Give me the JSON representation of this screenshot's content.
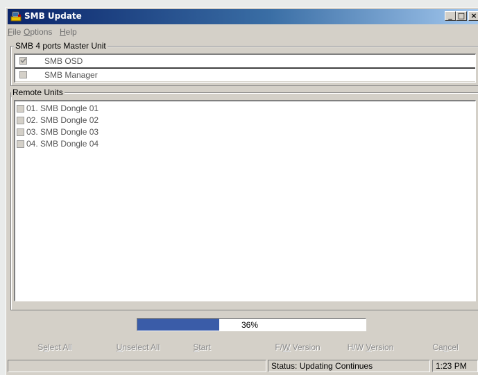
{
  "window": {
    "title": "SMB Update",
    "controls": {
      "minimize": "_",
      "maximize": "□",
      "close": "×"
    }
  },
  "menu": [
    {
      "key": "F",
      "rest": "ile"
    },
    {
      "key": "O",
      "rest": "ptions"
    },
    {
      "key": "H",
      "rest": "elp"
    }
  ],
  "master_unit": {
    "label": "SMB 4 ports Master Unit",
    "items": [
      {
        "label": "SMB OSD",
        "checked": true
      },
      {
        "label": "SMB Manager",
        "checked": false
      }
    ]
  },
  "remote_units": {
    "label": "Remote Units",
    "items": [
      {
        "label": "01. SMB Dongle 01",
        "checked": false
      },
      {
        "label": "02. SMB Dongle 02",
        "checked": false
      },
      {
        "label": "03. SMB Dongle 03",
        "checked": false
      },
      {
        "label": "04. SMB Dongle 04",
        "checked": false
      }
    ]
  },
  "progress": {
    "percent": 36,
    "text": "36%"
  },
  "buttons": {
    "select_all": {
      "pre": "S",
      "key": "e",
      "post": "lect All"
    },
    "unselect_all": {
      "pre": "",
      "key": "U",
      "post": "nselect All"
    },
    "start": {
      "pre": "",
      "key": "S",
      "post": "tart"
    },
    "fw_version": {
      "pre": "F/",
      "key": "W",
      "post": " Version"
    },
    "hw_version": {
      "pre": "H/W ",
      "key": "V",
      "post": "ersion"
    },
    "cancel": {
      "pre": "Ca",
      "key": "n",
      "post": "cel"
    }
  },
  "status": {
    "text": "Status: Updating Continues",
    "time": "1:23 PM"
  },
  "colors": {
    "progress_fill": "#3a5ca8",
    "title_gradient_start": "#0a246a"
  }
}
